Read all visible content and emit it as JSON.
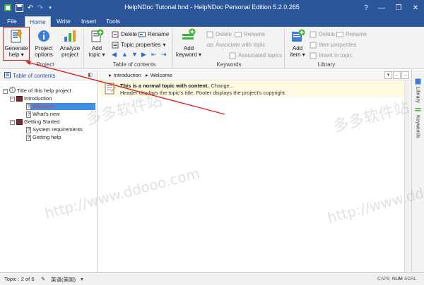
{
  "window": {
    "title": "HelpNDoc Tutorial.hnd - HelpNDoc Personal Edition 5.2.0.265",
    "icon": "helpndoc-app-icon"
  },
  "quick_access": {
    "icons": [
      "save-icon",
      "undo-icon",
      "redo-icon",
      "dropdown-icon"
    ]
  },
  "window_controls": {
    "icons": [
      "help-icon",
      "minimize-icon",
      "restore-icon",
      "close-icon"
    ]
  },
  "tabs": [
    {
      "label": "File",
      "active": false
    },
    {
      "label": "Home",
      "active": true
    },
    {
      "label": "Write",
      "active": false
    },
    {
      "label": "Insert",
      "active": false
    },
    {
      "label": "Tools",
      "active": false
    }
  ],
  "ribbon": {
    "project": {
      "label": "Project",
      "generate": {
        "line1": "Generate",
        "line2": "help",
        "arrow": "▾"
      },
      "options": {
        "line1": "Project",
        "line2": "options"
      },
      "analyze": {
        "line1": "Analyze",
        "line2": "project"
      }
    },
    "toc": {
      "label": "Table of contents",
      "add": {
        "line1": "Add",
        "line2": "topic"
      },
      "delete": "Delete",
      "rename": "Rename",
      "properties": "Topic properties"
    },
    "keywords": {
      "label": "Keywords",
      "add": {
        "line1": "Add",
        "line2": "keyword"
      },
      "delete": "Delete",
      "rename": "Rename",
      "associate": "Associate with topic",
      "associated": "Associated topics"
    },
    "library": {
      "label": "Library",
      "add": {
        "line1": "Add",
        "line2": "item"
      },
      "delete": "Delete",
      "rename": "Rename",
      "properties": "Item properties",
      "insert": "Insert in topic"
    },
    "accent_color": "#2b579a",
    "highlight_color": "#e02020"
  },
  "sidebar": {
    "header": "Table of contents",
    "tree": [
      {
        "label": "Title of this help project",
        "level": 0,
        "type": "root",
        "expander": "−"
      },
      {
        "label": "Introduction",
        "level": 1,
        "type": "book",
        "expander": "−"
      },
      {
        "label": "Welcome",
        "level": 2,
        "type": "topic",
        "selected": true
      },
      {
        "label": "What's new",
        "level": 2,
        "type": "topic"
      },
      {
        "label": "Getting Started",
        "level": 1,
        "type": "book",
        "expander": "−"
      },
      {
        "label": "System requirements",
        "level": 2,
        "type": "topic"
      },
      {
        "label": "Getting help",
        "level": 2,
        "type": "topic"
      }
    ]
  },
  "breadcrumb": [
    "Introduction",
    "Welcome"
  ],
  "topic_header": {
    "title": "This is a normal topic with content.",
    "change": "Change...",
    "description": "Header displays the topic's title.  Footer displays the project's copyright."
  },
  "right_tabs": [
    "Library",
    "Keywords"
  ],
  "status": {
    "topic": "Topic : 2 of 6",
    "language": "英语(美国)",
    "caps": "CAPS",
    "num": "NUM",
    "scrl": "SCRL"
  },
  "watermark": {
    "cn": "多多软件站",
    "url": "http://www.ddooo.com"
  }
}
